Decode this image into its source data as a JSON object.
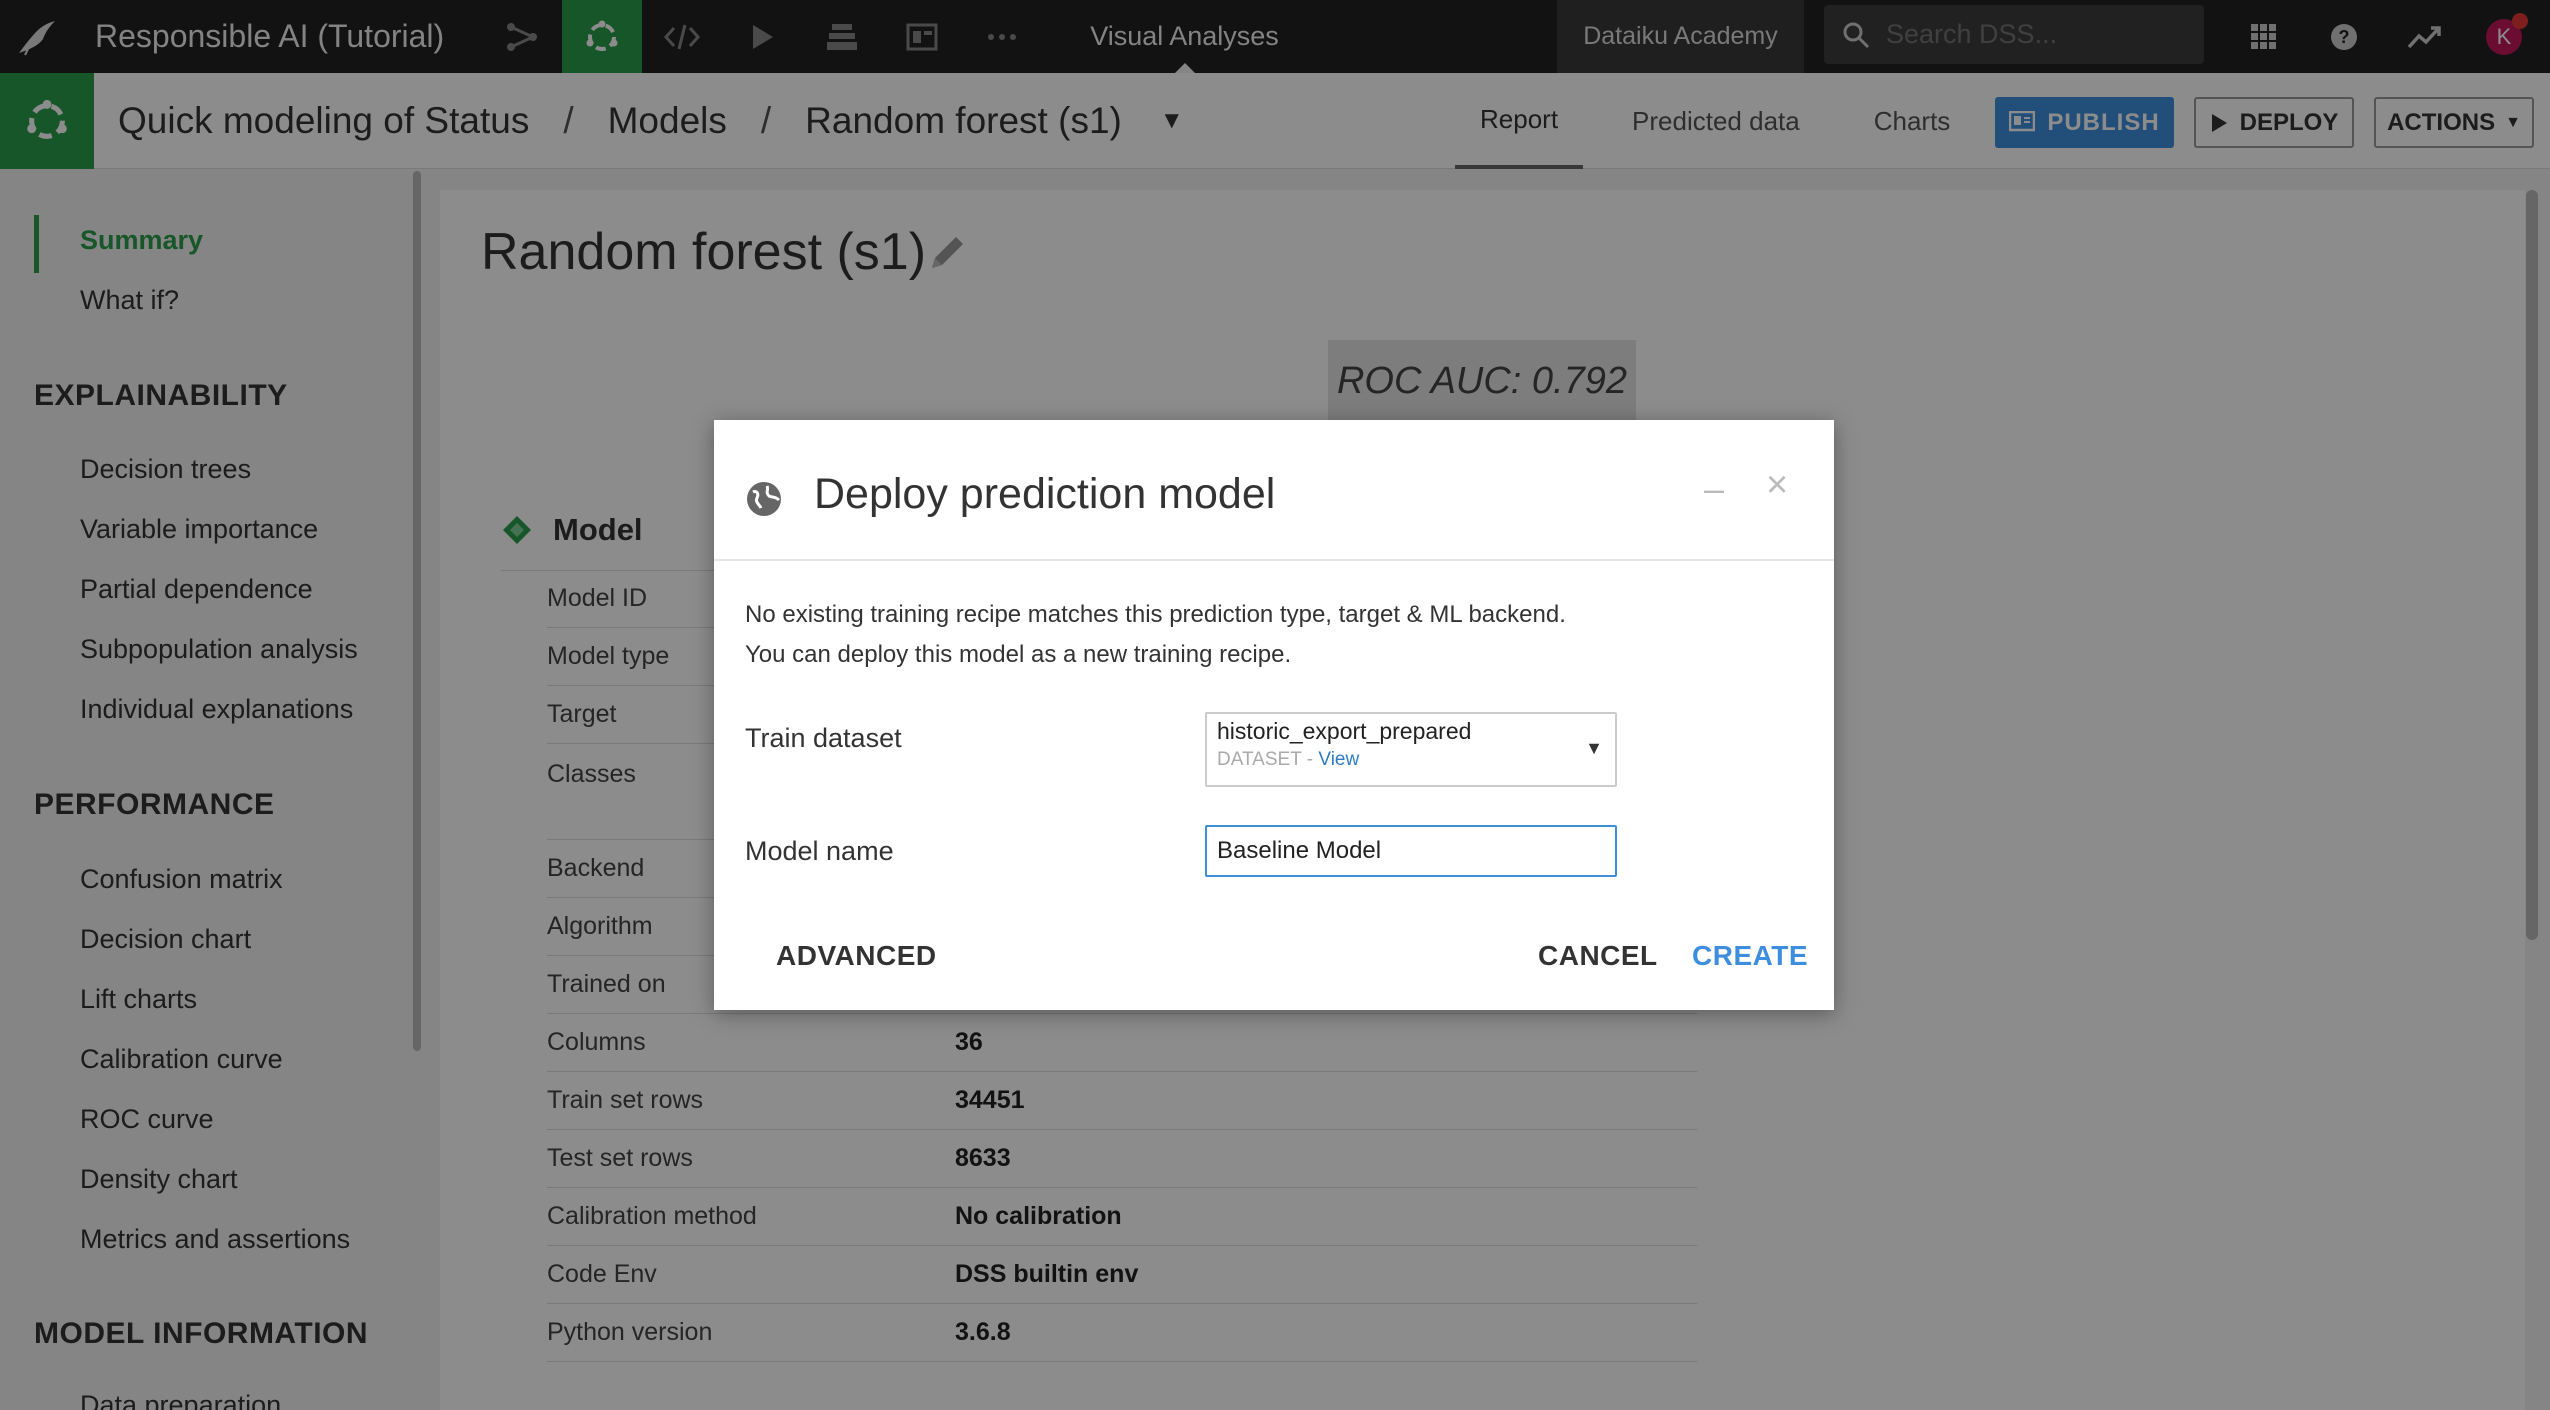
{
  "topnav": {
    "project_name": "Responsible AI (Tutorial)",
    "section": "Visual Analyses",
    "academy": "Dataiku Academy",
    "search_placeholder": "Search DSS...",
    "avatar_initial": "K",
    "icons": [
      "dataiku-bird-icon",
      "flow-icon",
      "lab-icon",
      "code-icon",
      "run-icon",
      "datasets-icon",
      "dashboard-icon",
      "more-icon",
      "search-icon",
      "apps-grid-icon",
      "help-icon",
      "trend-icon"
    ]
  },
  "subbar": {
    "breadcrumb": [
      "Quick modeling of Status",
      "Models",
      "Random forest (s1)"
    ],
    "tabs": [
      "Report",
      "Predicted data",
      "Charts"
    ],
    "active_tab": "Report",
    "publish_label": "PUBLISH",
    "deploy_label": "DEPLOY",
    "actions_label": "ACTIONS"
  },
  "sidebar": {
    "top_items": [
      "Summary",
      "What if?"
    ],
    "active_item": "Summary",
    "sections": [
      {
        "heading": "EXPLAINABILITY",
        "items": [
          "Decision trees",
          "Variable importance",
          "Partial dependence",
          "Subpopulation analysis",
          "Individual explanations"
        ]
      },
      {
        "heading": "PERFORMANCE",
        "items": [
          "Confusion matrix",
          "Decision chart",
          "Lift charts",
          "Calibration curve",
          "ROC curve",
          "Density chart",
          "Metrics and assertions"
        ]
      },
      {
        "heading": "MODEL INFORMATION",
        "items": [
          "Data preparation"
        ]
      }
    ]
  },
  "report": {
    "title": "Random forest (s1)",
    "roc_auc": "ROC AUC: 0.792",
    "section_title": "Model",
    "rows": [
      {
        "key": "Model ID",
        "value": ""
      },
      {
        "key": "Model type",
        "value": ""
      },
      {
        "key": "Target",
        "value": ""
      },
      {
        "key": "Classes",
        "value": ""
      },
      {
        "key": "Backend",
        "value": ""
      },
      {
        "key": "Algorithm",
        "value": ""
      },
      {
        "key": "Trained on",
        "value": ""
      },
      {
        "key": "Columns",
        "value": "36"
      },
      {
        "key": "Train set rows",
        "value": "34451"
      },
      {
        "key": "Test set rows",
        "value": "8633"
      },
      {
        "key": "Calibration method",
        "value": "No calibration"
      },
      {
        "key": "Code Env",
        "value": "DSS builtin env"
      },
      {
        "key": "Python version",
        "value": "3.6.8"
      }
    ]
  },
  "modal": {
    "title": "Deploy prediction model",
    "line1": "No existing training recipe matches this prediction type, target & ML backend.",
    "line2": "You can deploy this model as a new training recipe.",
    "train_dataset_label": "Train dataset",
    "train_dataset_value": "historic_export_prepared",
    "train_dataset_type": "DATASET",
    "train_dataset_sep": " - ",
    "train_dataset_link": "View",
    "model_name_label": "Model name",
    "model_name_value": "Baseline Model",
    "advanced_label": "ADVANCED",
    "cancel_label": "CANCEL",
    "create_label": "CREATE"
  },
  "colors": {
    "accent_green": "#2a9d49",
    "primary_blue": "#3e8ede",
    "topbar": "#222222"
  }
}
